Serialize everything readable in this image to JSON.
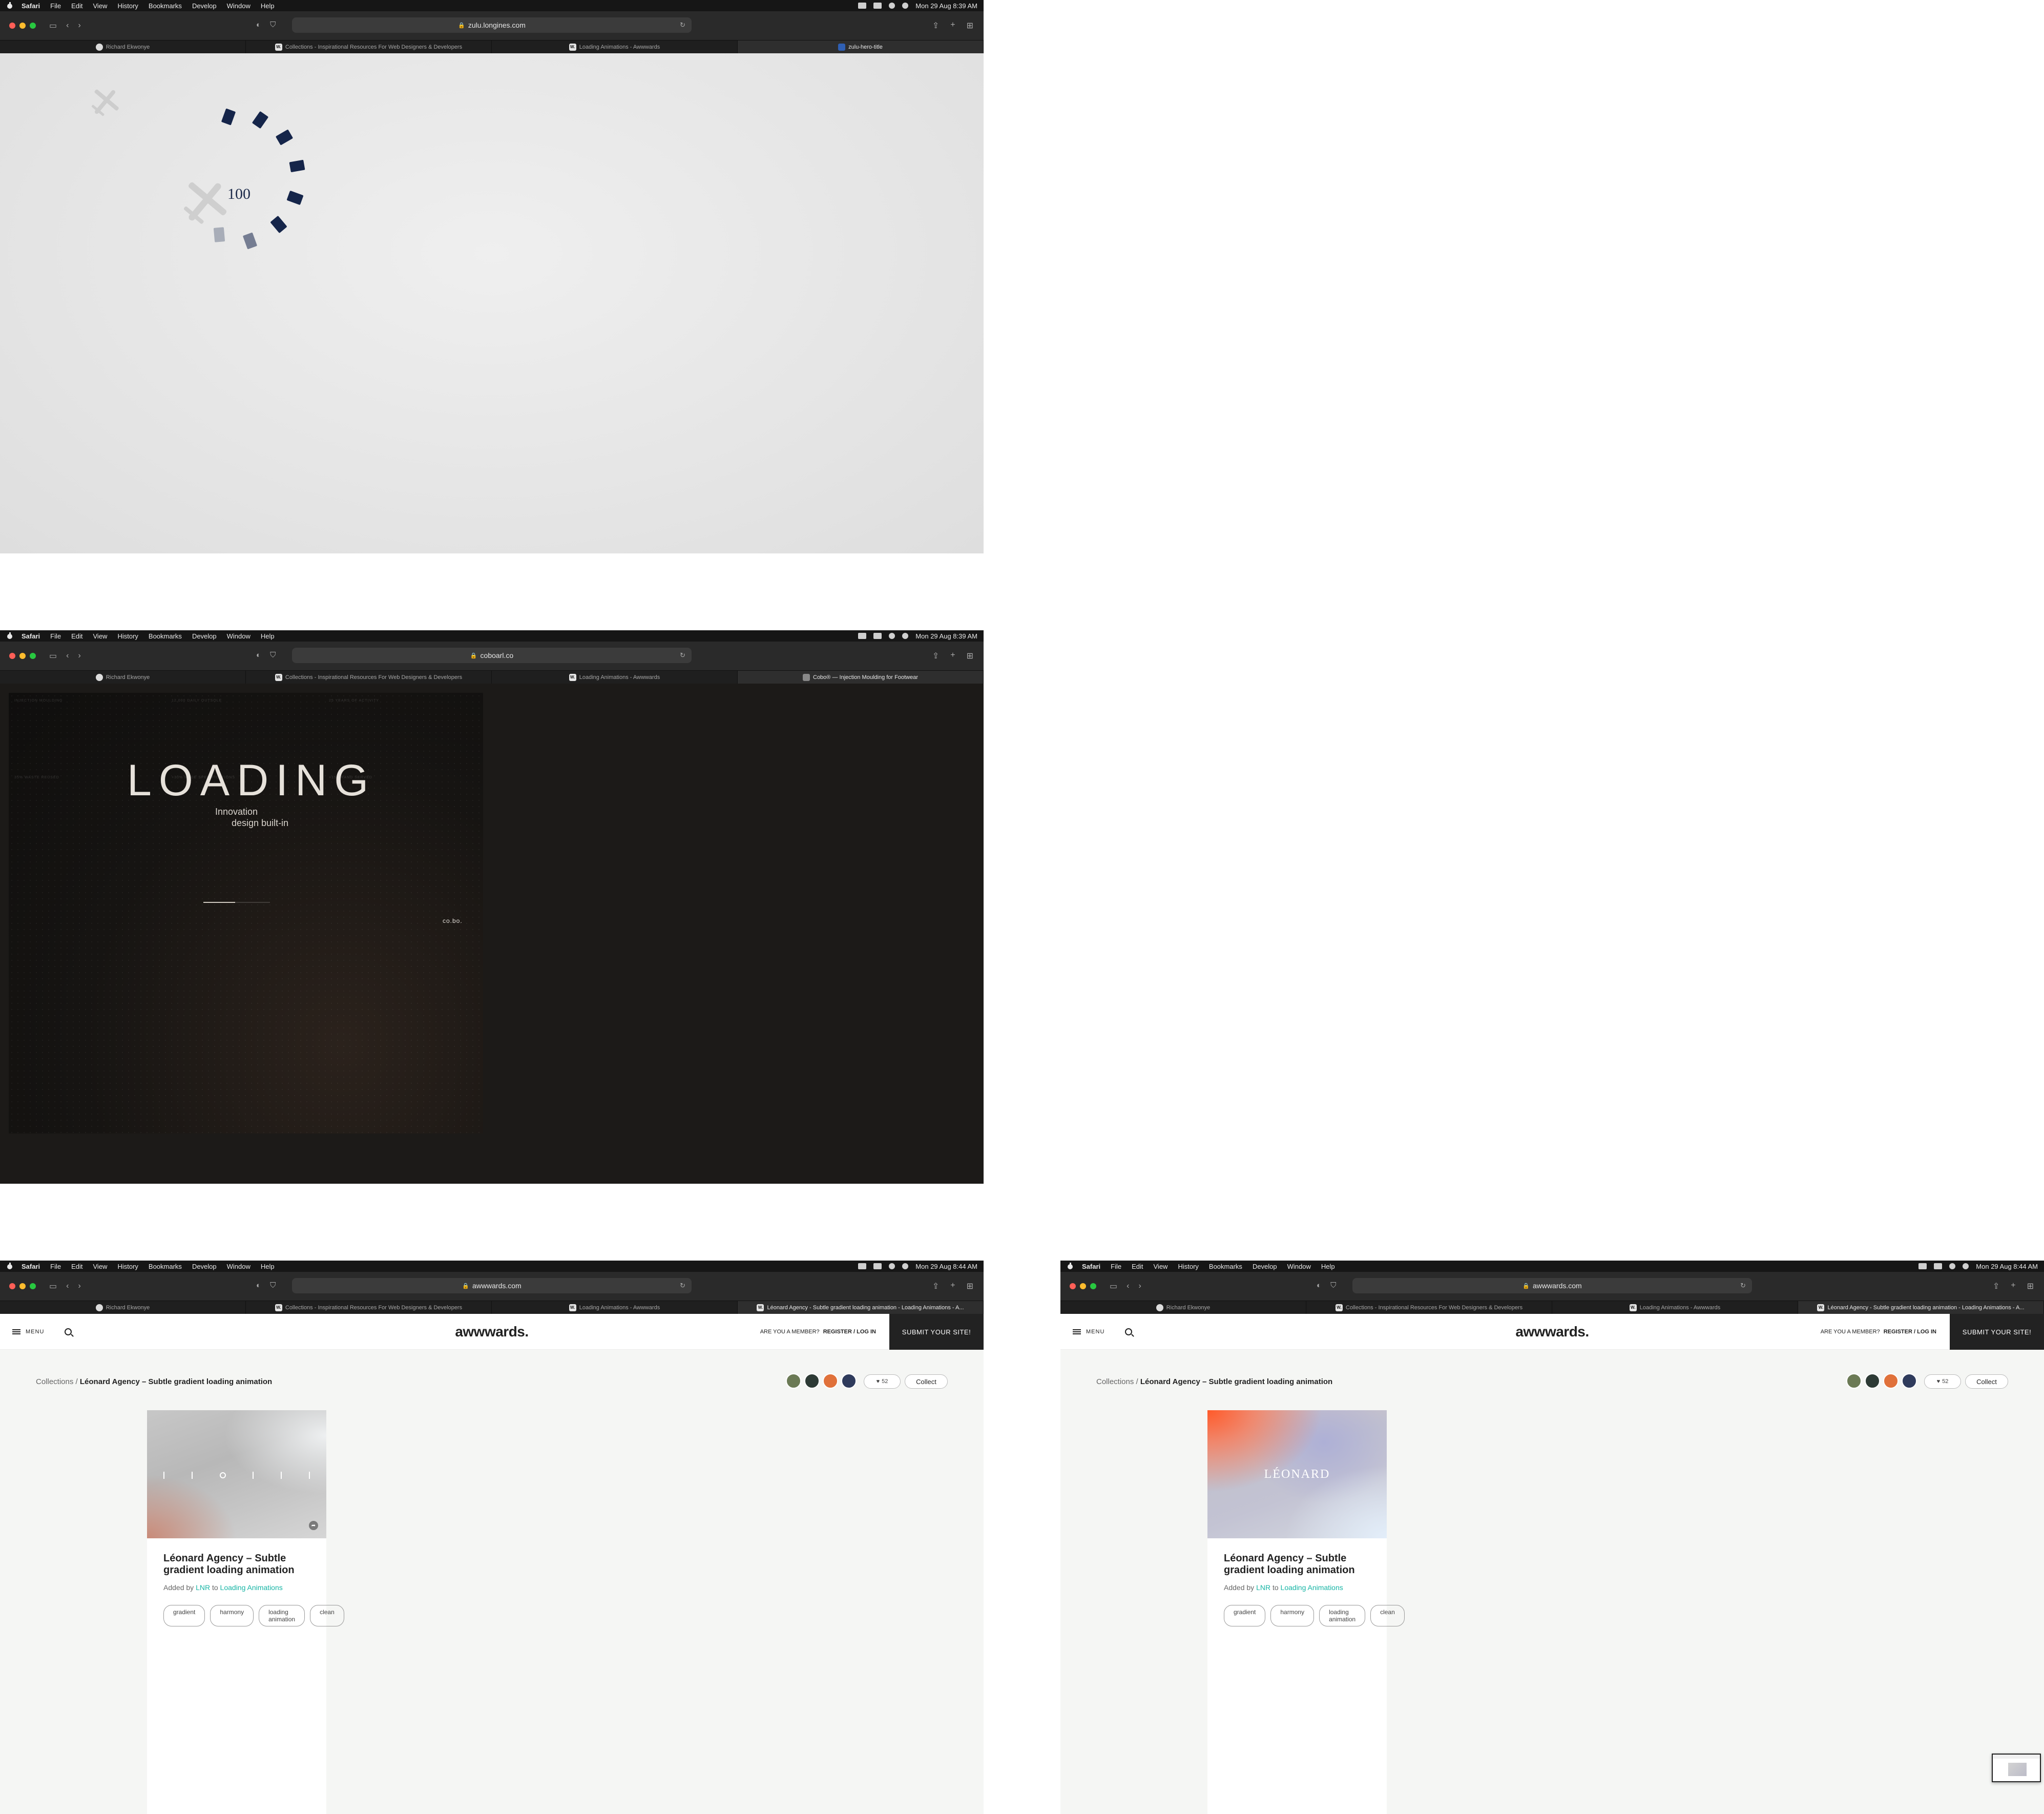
{
  "menubar": {
    "apple": "apple-icon",
    "items": [
      "Safari",
      "File",
      "Edit",
      "View",
      "History",
      "Bookmarks",
      "Develop",
      "Window",
      "Help"
    ]
  },
  "tabs": {
    "tab1": "Richard Ekwonye",
    "tab2": "Collections - Inspirational Resources For Web Designers & Developers",
    "tab3": "Loading Animations - Awwwards"
  },
  "shot1": {
    "clock": "Mon 29 Aug  8:39 AM",
    "url": "zulu.longines.com",
    "active_tab": "zulu-hero-title",
    "counter": "100"
  },
  "shot2": {
    "clock": "Mon 29 Aug  8:39 AM",
    "url": "coboarl.co",
    "active_tab": "Cobo® — Injection Moulding for Footwear",
    "faint": {
      "a": "INJECTION MOULDING",
      "b": "12,000 DAILY OUTSOLE",
      "c": "25 YEARS OF ACTIVITY",
      "d": "35% WASTE REUSED",
      "e": "+30% MADE SPECIFICATIONS",
      "f": "+15 BRAND SERVED"
    },
    "loading": "LOADING",
    "tagline_1": "Innovation",
    "tagline_2": "design built-in",
    "logo": "co.bo.",
    "progress": 0.48
  },
  "awwwards": {
    "clock": "Mon 29 Aug  8:44 AM",
    "url": "awwwards.com",
    "active_tab": "Léonard Agency - Subtle gradient loading animation - Loading Animations - A...",
    "menu_label": "MENU",
    "logo": "awwwards.",
    "member_q": "ARE YOU A MEMBER?",
    "member_link": "REGISTER / LOG IN",
    "submit": "SUBMIT YOUR SITE!",
    "breadcrumb_root": "Collections",
    "breadcrumb_sep": "/",
    "breadcrumb_current": "Léonard Agency – Subtle gradient loading animation",
    "likes": "52",
    "collect": "Collect",
    "card_title": "Léonard Agency – Subtle gradient loading animation",
    "added_by": "Added by",
    "author": "LNR",
    "to": "to",
    "collection": "Loading Animations",
    "tags": [
      "gradient",
      "harmony",
      "loading animation",
      "clean"
    ],
    "wordmark": "LÉONARD"
  },
  "colors": {
    "navy": "#15254a",
    "accent_link": "#17b5a5",
    "dark_panel": "#161412"
  }
}
